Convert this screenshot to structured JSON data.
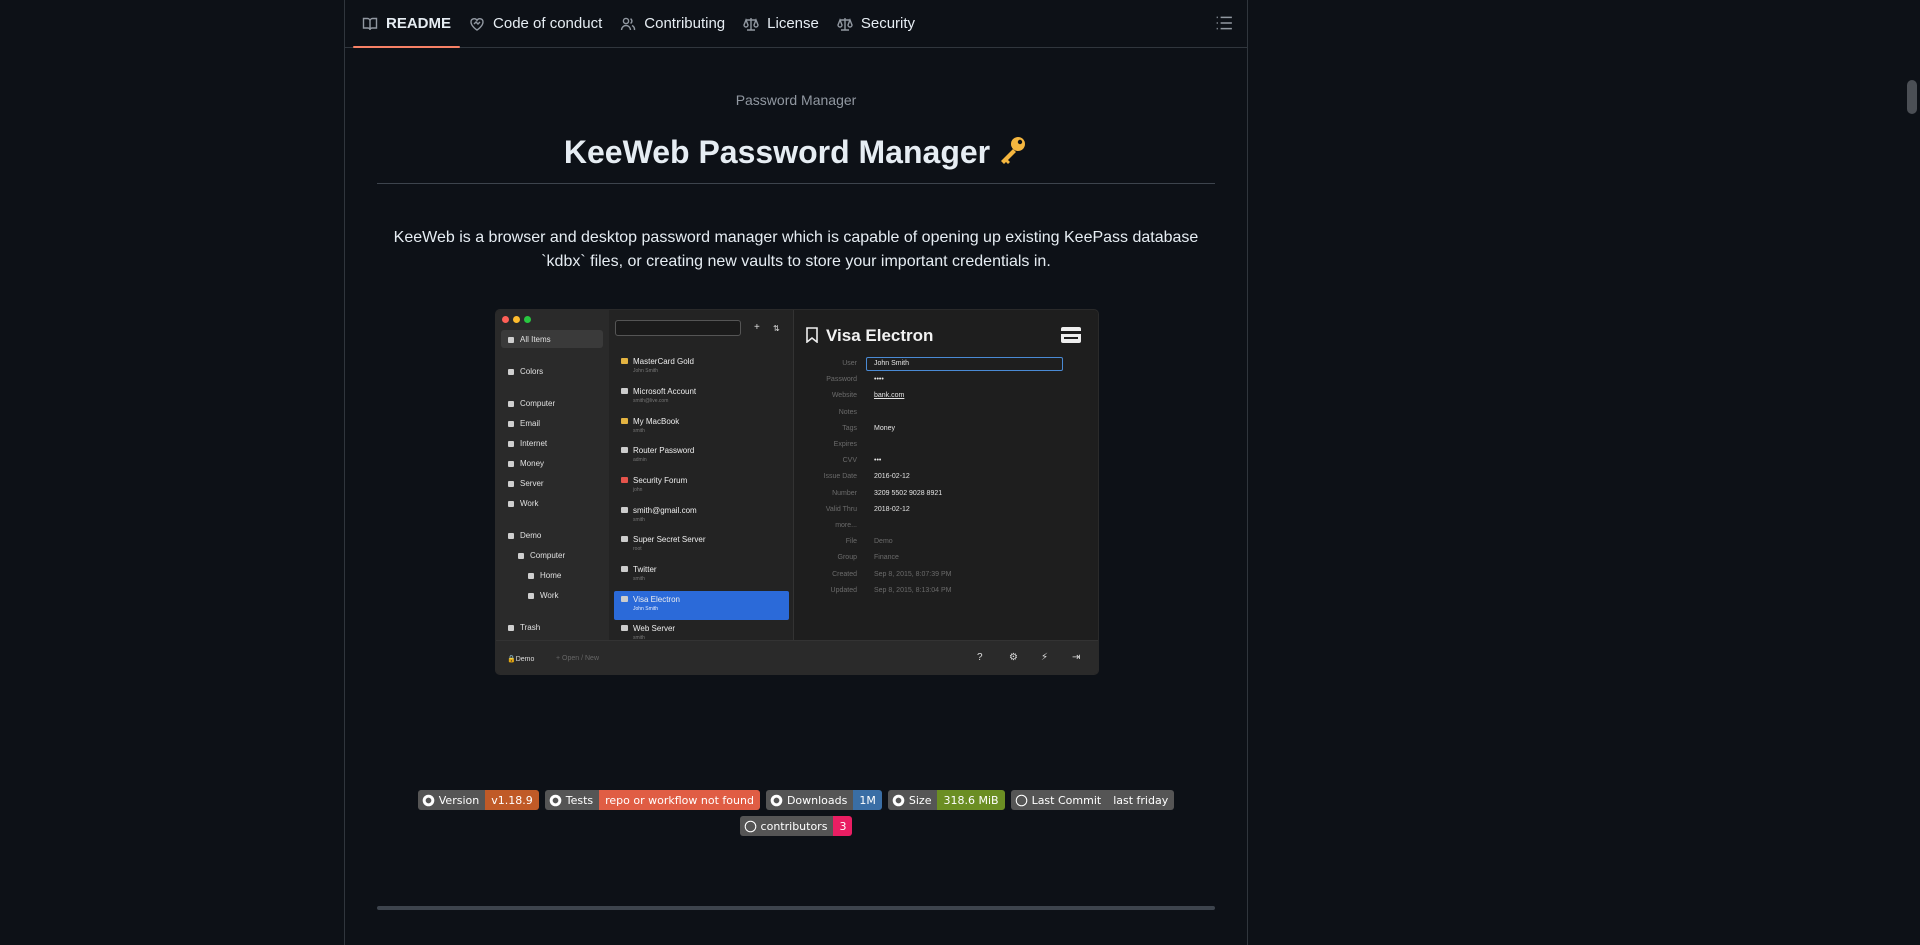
{
  "tabs": [
    {
      "label": "README",
      "icon": "book-icon",
      "active": true
    },
    {
      "label": "Code of conduct",
      "icon": "heart-icon",
      "active": false
    },
    {
      "label": "Contributing",
      "icon": "people-icon",
      "active": false
    },
    {
      "label": "License",
      "icon": "law-icon",
      "active": false
    },
    {
      "label": "Security",
      "icon": "law-icon",
      "active": false
    }
  ],
  "readme": {
    "subtitle": "Password Manager",
    "title": "KeeWeb Password Manager",
    "description": "KeeWeb is a browser and desktop password manager which is capable of opening up existing KeePass database `kdbx` files, or creating new vaults to store your important credentials in."
  },
  "app": {
    "sidebar": [
      "All Items",
      "Colors",
      "Computer",
      "Email",
      "Internet",
      "Money",
      "Server",
      "Work",
      "Demo",
      "Computer",
      "Home",
      "Work",
      "Trash"
    ],
    "entries": [
      {
        "title": "MasterCard Gold",
        "sub": "John Smith"
      },
      {
        "title": "Microsoft Account",
        "sub": "smith@live.com"
      },
      {
        "title": "My MacBook",
        "sub": "smith"
      },
      {
        "title": "Router Password",
        "sub": "admin"
      },
      {
        "title": "Security Forum",
        "sub": "john"
      },
      {
        "title": "smith@gmail.com",
        "sub": "smith"
      },
      {
        "title": "Super Secret Server",
        "sub": "root"
      },
      {
        "title": "Twitter",
        "sub": "smith"
      },
      {
        "title": "Visa Electron",
        "sub": "John Smith"
      },
      {
        "title": "Web Server",
        "sub": "smith"
      }
    ],
    "detail_title": "Visa Electron",
    "fields": [
      {
        "label": "User",
        "value": "John Smith"
      },
      {
        "label": "Password",
        "value": "••••"
      },
      {
        "label": "Website",
        "value": "bank.com"
      },
      {
        "label": "Notes",
        "value": ""
      },
      {
        "label": "Tags",
        "value": "Money"
      },
      {
        "label": "Expires",
        "value": ""
      },
      {
        "label": "CVV",
        "value": "•••"
      },
      {
        "label": "Issue Date",
        "value": "2016-02-12"
      },
      {
        "label": "Number",
        "value": "3209 5502 9028 8921"
      },
      {
        "label": "Valid Thru",
        "value": "2018-02-12"
      },
      {
        "label": "more...",
        "value": ""
      },
      {
        "label": "File",
        "value": "Demo"
      },
      {
        "label": "Group",
        "value": "Finance"
      },
      {
        "label": "Created",
        "value": "Sep 8, 2015, 8:07:39 PM"
      },
      {
        "label": "Updated",
        "value": "Sep 8, 2015, 8:13:04 PM"
      }
    ],
    "footer_db": "Demo",
    "footer_open": "+ Open / New"
  },
  "badges": [
    {
      "label": "Version",
      "value": "v1.18.9",
      "color": "#c05a27"
    },
    {
      "label": "Tests",
      "value": "repo or workflow not found",
      "color": "#e05d44"
    },
    {
      "label": "Downloads",
      "value": "1M",
      "color": "#3a6ea5"
    },
    {
      "label": "Size",
      "value": "318.6 MiB",
      "color": "#6b8e23"
    },
    {
      "label": "Last Commit",
      "value": "last friday",
      "color": "#555555"
    }
  ],
  "badges2": [
    {
      "label": "contributors",
      "value": "3",
      "color": "#e91e63"
    }
  ]
}
